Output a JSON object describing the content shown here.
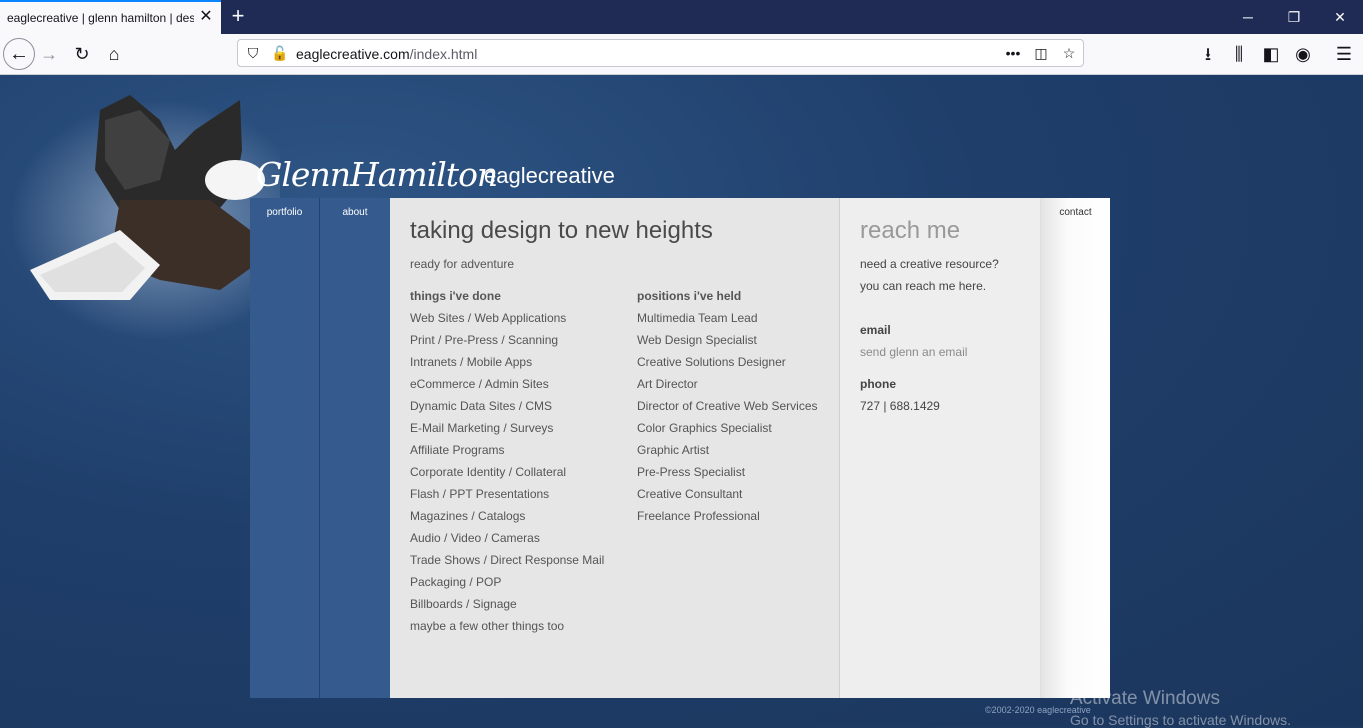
{
  "browser": {
    "tab_title": "eaglecreative | glenn hamilton | design",
    "url_domain": "eaglecreative.com",
    "url_path": "/index.html"
  },
  "header": {
    "signature": "GlennHamilton",
    "site_name": "eaglecreative"
  },
  "nav": {
    "portfolio": "portfolio",
    "about": "about",
    "contact": "contact"
  },
  "main": {
    "headline": "taking design to new heights",
    "tagline": "ready for adventure",
    "done_heading": "things i've done",
    "done_items": [
      "Web Sites / Web Applications",
      "Print / Pre-Press / Scanning",
      "Intranets / Mobile Apps",
      "eCommerce / Admin Sites",
      "Dynamic Data Sites / CMS",
      "E-Mail Marketing / Surveys",
      "Affiliate Programs",
      "Corporate Identity / Collateral",
      "Flash / PPT Presentations",
      "Magazines / Catalogs",
      "Audio / Video / Cameras",
      "Trade Shows / Direct Response Mail",
      "Packaging / POP",
      "Billboards / Signage",
      "maybe a few other things too"
    ],
    "held_heading": "positions i've held",
    "held_items": [
      "Multimedia Team Lead",
      "Web Design Specialist",
      "Creative Solutions Designer",
      "Art Director",
      "Director of Creative Web Services",
      "Color Graphics Specialist",
      "Graphic Artist",
      "Pre-Press Specialist",
      "Creative Consultant",
      "Freelance Professional"
    ]
  },
  "reach": {
    "title": "reach me",
    "line1": "need a creative resource?",
    "line2": "you can reach me here.",
    "email_label": "email",
    "email_link": "send glenn an email",
    "phone_label": "phone",
    "phone": "727 | 688.1429"
  },
  "footer": {
    "copyright": "©2002-2020 eaglecreative"
  },
  "watermark": {
    "line1": "Activate Windows",
    "line2": "Go to Settings to activate Windows."
  }
}
